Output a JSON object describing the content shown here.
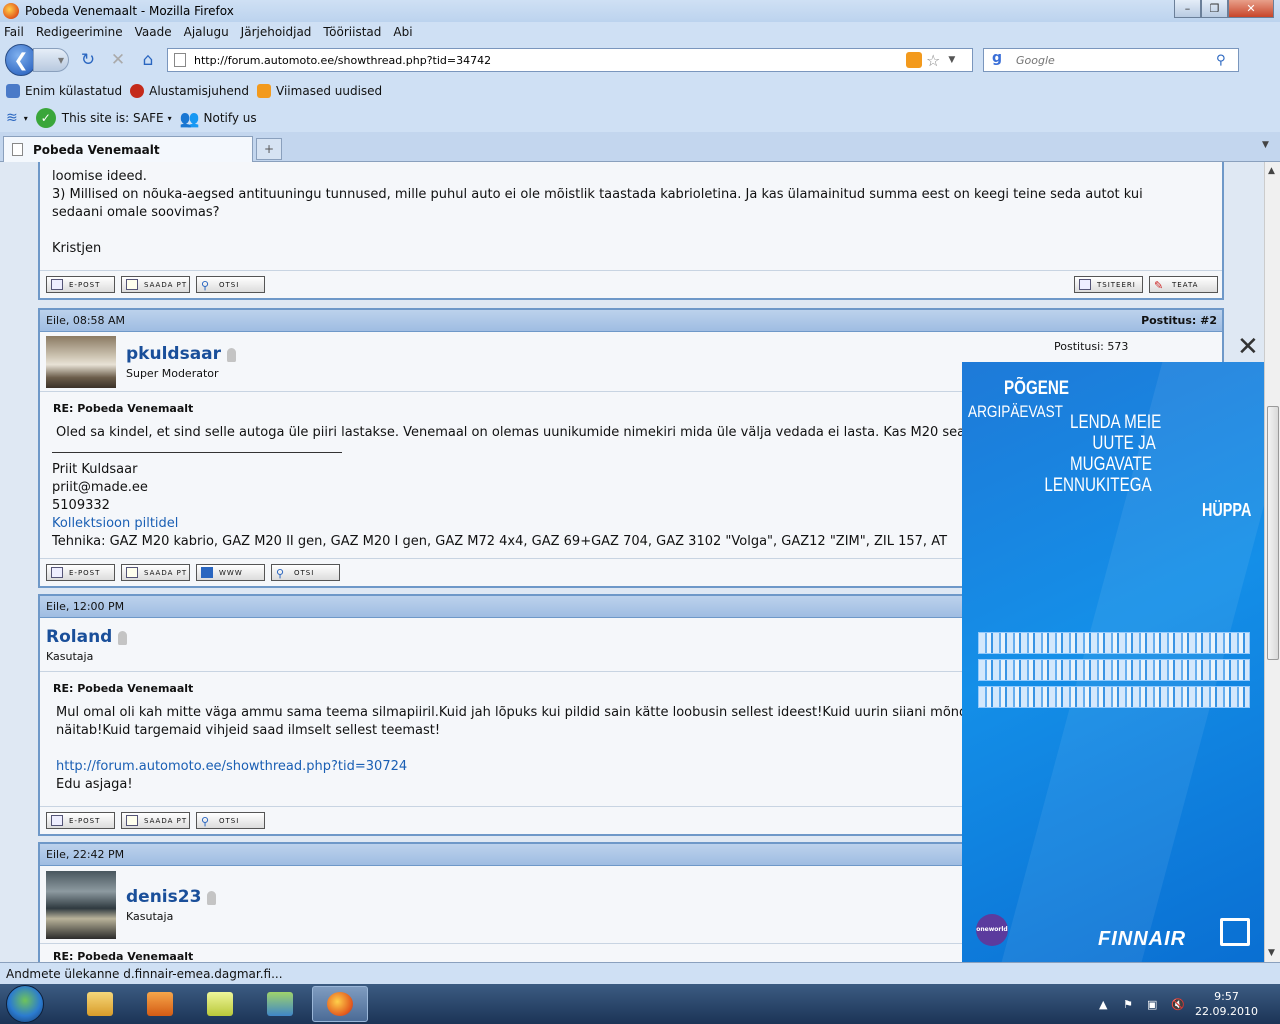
{
  "window": {
    "title": "Pobeda Venemaalt - Mozilla Firefox"
  },
  "menu": [
    "Fail",
    "Redigeerimine",
    "Vaade",
    "Ajalugu",
    "Järjehoidjad",
    "Tööriistad",
    "Abi"
  ],
  "nav": {
    "url": "http://forum.automoto.ee/showthread.php?tid=34742",
    "search_placeholder": "Google"
  },
  "bookmarks": [
    "Enim külastatud",
    "Alustamisjuhend",
    "Viimased uudised"
  ],
  "toolbar2": {
    "safe": "This site is: SAFE",
    "notify": "Notify us"
  },
  "tab": {
    "title": "Pobeda Venemaalt",
    "newtab": "+"
  },
  "post1": {
    "line_top": "loomise ideed.",
    "line2": "3) Millised on nõuka-aegsed antituuningu tunnused, mille puhul auto ei ole mõistlik taastada kabrioletina. Ja kas ülamainitud summa eest on keegi teine seda autot kui",
    "line3": "sedaani omale soovimas?",
    "line4": "Kristjen",
    "buttons": [
      "E-POST",
      "SAADA PT",
      "OTSI"
    ],
    "buttons_right": [
      "TSITEERI",
      "TEATA"
    ]
  },
  "post2": {
    "date": "Eile, 08:58 AM",
    "num": "Postitus: #2",
    "user": "pkuldsaar",
    "role": "Super Moderator",
    "stats": "Postitusi: 573",
    "title": "RE: Pobeda Venemaalt",
    "text": "Oled sa kindel, et sind selle autoga üle piiri lastakse. Venemaal on olemas uunikumide nimekiri mida üle välja vedada ei lasta. Kas M20 sea",
    "sig1": "Priit Kuldsaar",
    "sig2": "priit@made.ee",
    "sig3": "5109332",
    "sig_link": "Kollektsioon piltidel",
    "sig5": "Tehnika: GAZ M20 kabrio, GAZ M20 II gen, GAZ M20 I gen, GAZ M72 4x4, GAZ 69+GAZ 704, GAZ 3102 \"Volga\", GAZ12 \"ZIM\", ZIL 157, AT",
    "buttons": [
      "E-POST",
      "SAADA PT",
      "WWW",
      "OTSI"
    ]
  },
  "post3": {
    "date": "Eile, 12:00 PM",
    "user": "Roland",
    "role": "Kasutaja",
    "title": "RE: Pobeda Venemaalt",
    "text1": "Mul omal oli kah mitte väga ammu sama teema silmapiiril.Kuid jah lõpuks kui pildid sain kätte loobusin sellest ideest!Kuid uurin siiani mõnda",
    "text2": "näitab!Kuid targemaid vihjeid saad ilmselt sellest teemast!",
    "link": "http://forum.automoto.ee/showthread.php?tid=30724",
    "text3": "Edu asjaga!",
    "buttons": [
      "E-POST",
      "SAADA PT",
      "OTSI"
    ]
  },
  "post4": {
    "date": "Eile, 22:42 PM",
    "user": "denis23",
    "role": "Kasutaja",
    "title": "RE: Pobeda Venemaalt"
  },
  "ad": {
    "l1": "PÕGENE",
    "l2": "ARGIPÄEVAST",
    "l3a": "LENDA MEIE",
    "l3b": "UUTE JA",
    "l3c": "MUGAVATE",
    "l3d": "LENNUKITEGA",
    "l4": "HÜPPA",
    "oneworld": "oneworld",
    "brand": "FINNAIR",
    "close": "✕"
  },
  "status": "Andmete ülekanne d.finnair-emea.dagmar.fi...",
  "clock": {
    "time": "9:57",
    "date": "22.09.2010"
  }
}
